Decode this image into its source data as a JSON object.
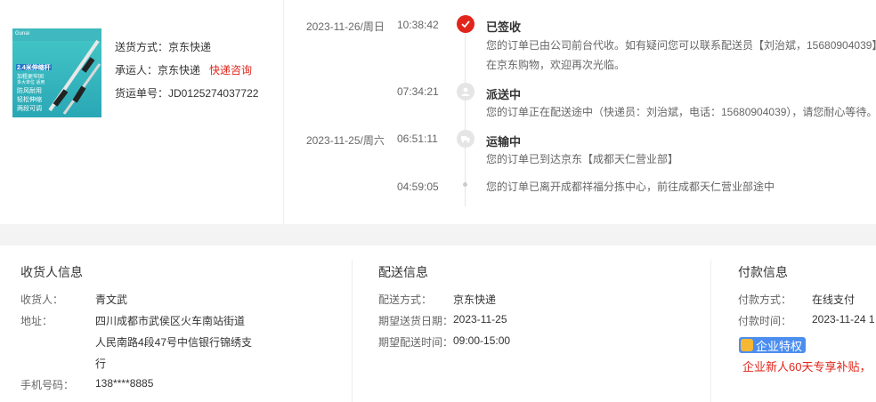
{
  "shipment": {
    "method_label": "送货方式：",
    "method_value": "京东快递",
    "carrier_label": "承运人：",
    "carrier_value": "京东快递",
    "carrier_link": "快递咨询",
    "tracking_label": "货运单号：",
    "tracking_value": "JD0125274037722"
  },
  "product_thumb": {
    "brand": "Gunai",
    "line1": "2.4米伸缩杆",
    "line2": "加粗更牢固",
    "line3": "多大单位 适用",
    "tags": [
      "防风耐用",
      "轻松伸缩",
      "两段可调"
    ]
  },
  "timeline": [
    {
      "date": "2023-11-26/周日",
      "time": "10:38:42",
      "status": "已签收",
      "icon": "check-icon",
      "desc_lines": [
        "您的订单已由公司前台代收。如有疑问您可以联系配送员【刘治斌，15680904039】",
        "在京东购物，欢迎再次光临。"
      ]
    },
    {
      "date": "",
      "time": "07:34:21",
      "status": "派送中",
      "icon": "courier-icon",
      "desc_lines": [
        "您的订单正在配送途中（快递员：刘治斌，电话：15680904039），请您耐心等待。"
      ]
    },
    {
      "date": "2023-11-25/周六",
      "time": "06:51:11",
      "status": "运输中",
      "icon": "truck-icon",
      "desc_lines": [
        "您的订单已到达京东【成都天仁营业部】"
      ]
    },
    {
      "date": "",
      "time": "04:59:05",
      "status": "",
      "icon": "",
      "desc_lines": [
        "您的订单已离开成都祥福分拣中心，前往成都天仁营业部途中"
      ]
    }
  ],
  "consignee": {
    "title": "收货人信息",
    "name_label": "收货人：",
    "name_value": "青文武",
    "addr_label": "地址：",
    "addr_lines": [
      "四川成都市武侯区火车南站街道",
      "人民南路4段47号中信银行锦绣支",
      "行"
    ],
    "phone_label": "手机号码：",
    "phone_value": "138****8885"
  },
  "delivery": {
    "title": "配送信息",
    "method_label": "配送方式：",
    "method_value": "京东快递",
    "date_label": "期望送货日期：",
    "date_value": "2023-11-25",
    "time_label": "期望配送时间：",
    "time_value": "09:00-15:00"
  },
  "payment": {
    "title": "付款信息",
    "method_label": "付款方式：",
    "method_value": "在线支付",
    "time_label": "付款时间：",
    "time_value": "2023-11-24 1",
    "badge": "企业特权",
    "promo": "企业新人60天专享补贴，"
  },
  "colors": {
    "accent": "#e1251b",
    "badge": "#4c8ef0"
  }
}
